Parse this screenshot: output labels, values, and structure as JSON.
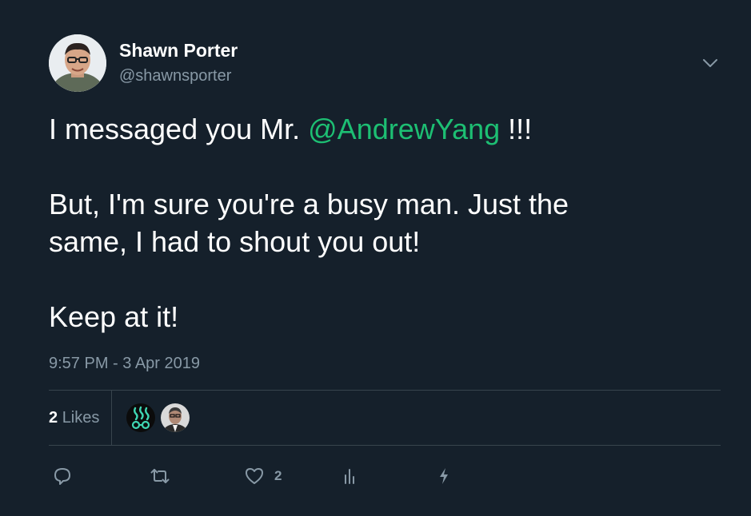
{
  "tweet": {
    "author": {
      "name": "Shawn Porter",
      "handle": "@shawnsporter"
    },
    "text": {
      "line1_prefix": "I messaged you Mr. ",
      "mention": "@AndrewYang",
      "line1_suffix": " !!!",
      "para2_line1": "But, I'm sure you're a busy man. Just the",
      "para2_line2": "same, I had to shout you out!",
      "para3": "Keep at it!"
    },
    "timestamp": "9:57 PM - 3 Apr 2019",
    "likes": {
      "count": "2",
      "label": "Likes"
    },
    "actions": {
      "reply_icon": "reply-icon",
      "retweet_icon": "retweet-icon",
      "like_icon": "heart-icon",
      "like_count": "2",
      "analytics_icon": "analytics-icon",
      "promote_icon": "lightning-icon"
    }
  },
  "colors": {
    "background": "#15202b",
    "text": "#ffffff",
    "secondary": "#8899a6",
    "mention": "#1dbf73",
    "divider": "#38444d"
  }
}
